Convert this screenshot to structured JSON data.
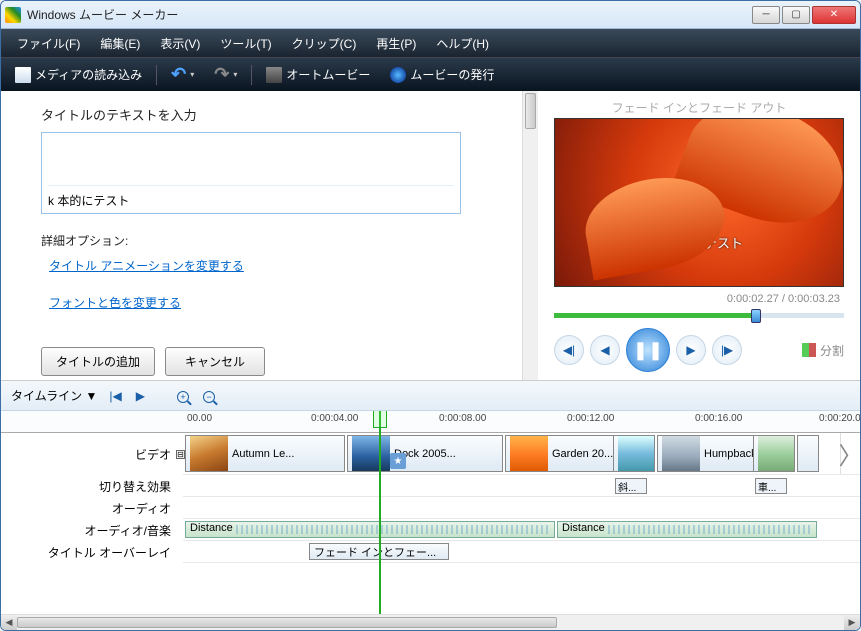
{
  "window": {
    "title": "Windows ムービー メーカー"
  },
  "menubar": [
    "ファイル(F)",
    "編集(E)",
    "表示(V)",
    "ツール(T)",
    "クリップ(C)",
    "再生(P)",
    "ヘルプ(H)"
  ],
  "toolbar": {
    "import": "メディアの読み込み",
    "automovie": "オートムービー",
    "publish": "ムービーの発行"
  },
  "title_editor": {
    "heading": "タイトルのテキストを入力",
    "value": "k 本的にテスト",
    "more_options": "詳細オプション:",
    "link_anim": "タイトル アニメーションを変更する",
    "link_font": "フォントと色を変更する",
    "add_btn": "タイトルの追加",
    "cancel_btn": "キャンセル"
  },
  "preview": {
    "fx_label": "フェード インとフェード アウト",
    "overlay_text": "k 本的にテスト",
    "time_current": "0:00:02.27",
    "time_total": "0:00:03.23",
    "split_label": "分割"
  },
  "timeline_toolbar": {
    "label": "タイムライン"
  },
  "tracks": {
    "video": "ビデオ",
    "transition": "切り替え効果",
    "audio": "オーディオ",
    "audio_music": "オーディオ/音楽",
    "title_overlay": "タイトル オーバーレイ"
  },
  "ruler": [
    "00.00",
    "0:00:04.00",
    "0:00:08.00",
    "0:00:12.00",
    "0:00:16.00",
    "0:00:20.0"
  ],
  "clips": {
    "c1": "Autumn Le...",
    "c2": "Dock 2005...",
    "c3": "Garden 20...",
    "c4": "Humpback...",
    "trans1": "斜...",
    "trans2": "車...",
    "audio1": "Distance",
    "audio2": "Distance",
    "title1": "フェード インとフェー..."
  },
  "toggle_minus": "⊟"
}
